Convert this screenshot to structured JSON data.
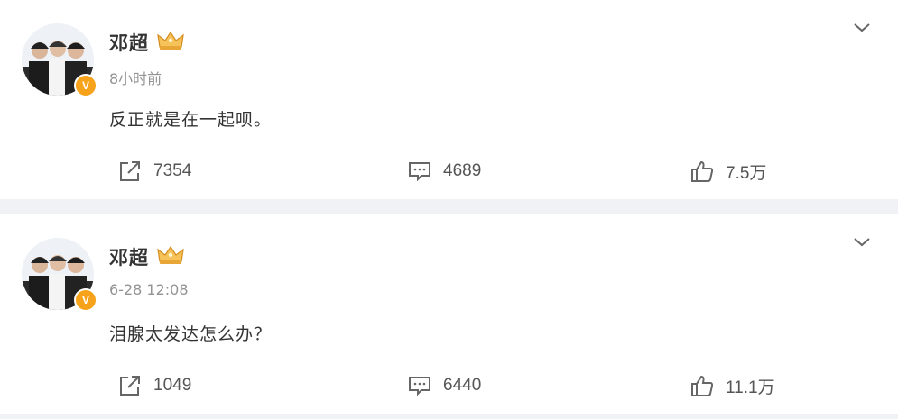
{
  "posts": [
    {
      "username": "邓超",
      "verified_symbol": "V",
      "timestamp": "8小时前",
      "content": "反正就是在一起呗。",
      "reposts": "7354",
      "comments": "4689",
      "likes": "7.5万"
    },
    {
      "username": "邓超",
      "verified_symbol": "V",
      "timestamp": "6-28 12:08",
      "content": "泪腺太发达怎么办？",
      "reposts": "1049",
      "comments": "6440",
      "likes": "11.1万"
    }
  ],
  "icons": {
    "repost": "repost-icon",
    "comment": "comment-icon",
    "like": "thumbs-up-icon",
    "menu": "chevron-down-icon",
    "crown": "crown-icon"
  },
  "colors": {
    "page_bg": "#f1f2f5",
    "card_bg": "#ffffff",
    "text_primary": "#333333",
    "text_secondary": "#939393",
    "verified_badge": "#f7a21b",
    "crown_gold": "#e8a637"
  }
}
